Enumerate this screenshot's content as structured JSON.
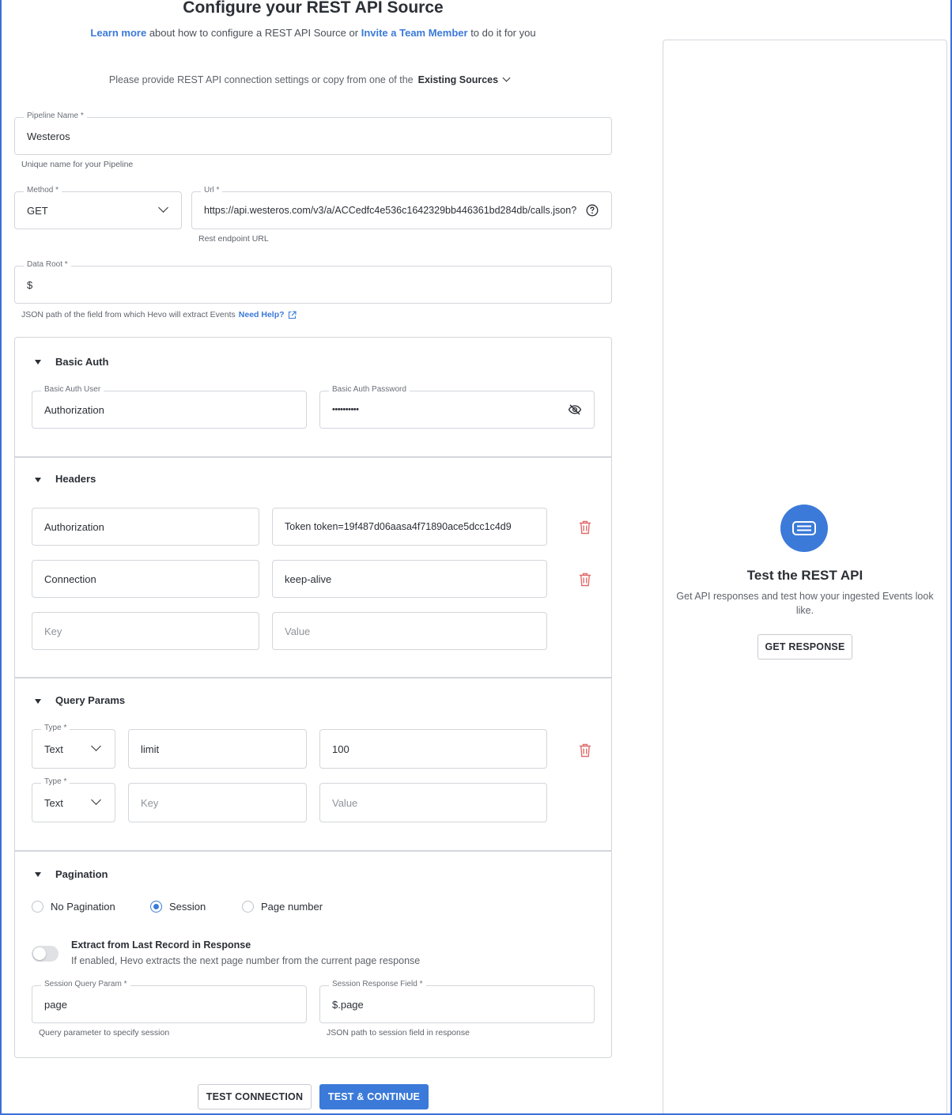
{
  "header": {
    "title": "Configure your REST API Source",
    "learn_more": "Learn more",
    "sub_mid": " about how to configure a REST API Source or ",
    "invite": "Invite a Team Member",
    "sub_end": " to do it for you",
    "provide_text": "Please provide REST API connection settings or copy from one of the",
    "existing_sources": "Existing Sources"
  },
  "pipeline": {
    "label": "Pipeline Name *",
    "value": "Westeros",
    "hint": "Unique name for your Pipeline"
  },
  "method": {
    "label": "Method *",
    "value": "GET"
  },
  "url": {
    "label": "Url *",
    "value": "https://api.westeros.com/v3/a/ACCedfc4e536c1642329bb446361bd284db/calls.json?",
    "hint": "Rest endpoint URL"
  },
  "data_root": {
    "label": "Data Root *",
    "value": "$",
    "hint": "JSON path of the field from which Hevo will extract Events",
    "help": "Need Help?"
  },
  "basic_auth": {
    "title": "Basic Auth",
    "user_label": "Basic Auth User",
    "user_value": "Authorization",
    "password_label": "Basic Auth Password",
    "password_value": "••••••••••"
  },
  "headers": {
    "title": "Headers",
    "rows": [
      {
        "key": "Authorization",
        "value": "Token token=19f487d06aasa4f71890ace5dcc1c4d9"
      },
      {
        "key": "Connection",
        "value": "keep-alive"
      }
    ],
    "key_placeholder": "Key",
    "value_placeholder": "Value"
  },
  "query_params": {
    "title": "Query Params",
    "type_label": "Type *",
    "rows": [
      {
        "type": "Text",
        "key": "limit",
        "value": "100"
      }
    ],
    "new_type": "Text",
    "key_placeholder": "Key",
    "value_placeholder": "Value"
  },
  "pagination": {
    "title": "Pagination",
    "options": [
      "No Pagination",
      "Session",
      "Page number"
    ],
    "selected": "Session",
    "extract_title": "Extract from Last Record in Response",
    "extract_desc": "If enabled, Hevo extracts the next page number from the current page response",
    "extract_enabled": false,
    "session_query_label": "Session Query Param *",
    "session_query_value": "page",
    "session_query_hint": "Query parameter to specify session",
    "session_response_label": "Session Response Field *",
    "session_response_value": "$.page",
    "session_response_hint": "JSON path to session field in response"
  },
  "actions": {
    "test_connection": "TEST CONNECTION",
    "test_continue": "TEST & CONTINUE"
  },
  "right_panel": {
    "title": "Test the REST API",
    "desc": "Get API responses and test how your ingested Events look like.",
    "button": "GET RESPONSE"
  },
  "colors": {
    "accent": "#3b7ad9",
    "danger": "#e06b6b",
    "border": "#d3d6db"
  },
  "icons": [
    "chevron-down-icon",
    "help-circle-icon",
    "external-link-icon",
    "eye-off-icon",
    "trash-icon",
    "api-icon"
  ]
}
